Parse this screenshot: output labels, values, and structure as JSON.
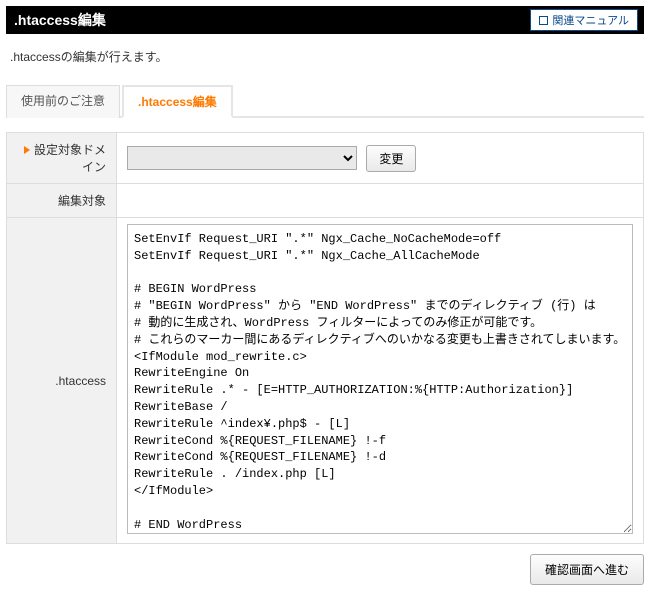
{
  "titlebar": {
    "title": ".htaccess編集",
    "manual_label": "関連マニュアル"
  },
  "description": ".htaccessの編集が行えます。",
  "tabs": {
    "pre_notice": "使用前のご注意",
    "edit": ".htaccess編集"
  },
  "form": {
    "domain_label": "設定対象ドメイン",
    "domain_selected": "",
    "change_button": "変更",
    "target_label": "編集対象",
    "target_value": "",
    "htaccess_label": ".htaccess",
    "htaccess_content": "SetEnvIf Request_URI \".*\" Ngx_Cache_NoCacheMode=off\nSetEnvIf Request_URI \".*\" Ngx_Cache_AllCacheMode\n\n# BEGIN WordPress\n# \"BEGIN WordPress\" から \"END WordPress\" までのディレクティブ (行) は\n# 動的に生成され、WordPress フィルターによってのみ修正が可能です。\n# これらのマーカー間にあるディレクティブへのいかなる変更も上書きされてしまいます。\n<IfModule mod_rewrite.c>\nRewriteEngine On\nRewriteRule .* - [E=HTTP_AUTHORIZATION:%{HTTP:Authorization}]\nRewriteBase /\nRewriteRule ^index¥.php$ - [L]\nRewriteCond %{REQUEST_FILENAME} !-f\nRewriteCond %{REQUEST_FILENAME} !-d\nRewriteRule . /index.php [L]\n</IfModule>\n\n# END WordPress"
  },
  "footer": {
    "proceed_button": "確認画面へ進む"
  }
}
